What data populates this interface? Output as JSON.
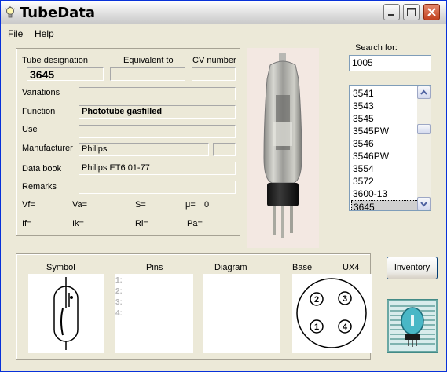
{
  "app": {
    "title": "TubeData"
  },
  "menu": {
    "file": "File",
    "help": "Help"
  },
  "header": {
    "designation_label": "Tube designation",
    "equivalent_label": "Equivalent to",
    "cv_label": "CV number",
    "designation_value": "3645",
    "equivalent_value": "",
    "cv_value": ""
  },
  "fields": {
    "variations_label": "Variations",
    "variations_value": "",
    "function_label": "Function",
    "function_value": "Phototube gasfilled",
    "use_label": "Use",
    "use_value": "",
    "manufacturer_label": "Manufacturer",
    "manufacturer_value": "Philips",
    "manufacturer_extra": "",
    "databook_label": "Data book",
    "databook_value": "Philips ET6  01-77",
    "remarks_label": "Remarks",
    "remarks_value": ""
  },
  "params": {
    "vf": "Vf=",
    "va": "Va=",
    "s": "S=",
    "mu": "μ=",
    "mu_value": "0",
    "if": "If=",
    "ik": "Ik=",
    "ri": "Ri=",
    "pa": "Pa="
  },
  "search": {
    "label": "Search for:",
    "value": "1005"
  },
  "list": {
    "items": [
      "3541",
      "3543",
      "3545",
      "3545PW",
      "3546",
      "3546PW",
      "3554",
      "3572",
      "3600-13",
      "3645"
    ],
    "selected": "3645"
  },
  "bottom": {
    "symbol_label": "Symbol",
    "pins_label": "Pins",
    "diagram_label": "Diagram",
    "base_label": "Base",
    "base_type": "UX4",
    "pins": [
      "1:",
      "2:",
      "3:",
      "4:"
    ],
    "base_pins": [
      "2",
      "3",
      "1",
      "4"
    ]
  },
  "buttons": {
    "inventory": "Inventory"
  },
  "colors": {
    "title_bar": "#dcdcdc",
    "window_bg": "#ece9d8",
    "close_button": "#c1401f",
    "list_border": "#7f9db9"
  },
  "icons": [
    "lightbulb-icon",
    "minimize-icon",
    "maximize-icon",
    "close-icon",
    "scroll-up-icon",
    "scroll-down-icon"
  ]
}
